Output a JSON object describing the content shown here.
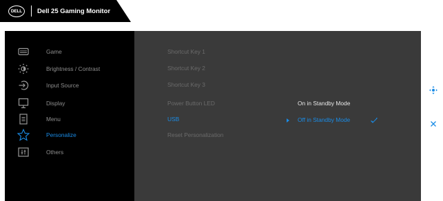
{
  "header": {
    "logo_text": "DELL",
    "title": "Dell 25 Gaming Monitor"
  },
  "menu": [
    {
      "label": "Game",
      "icon": "gamepad-icon",
      "active": false
    },
    {
      "label": "Brightness / Contrast",
      "icon": "brightness-icon",
      "active": false
    },
    {
      "label": "Input Source",
      "icon": "input-source-icon",
      "active": false
    },
    {
      "label": "Display",
      "icon": "display-icon",
      "active": false
    },
    {
      "label": "Menu",
      "icon": "menu-icon",
      "active": false
    },
    {
      "label": "Personalize",
      "icon": "star-icon",
      "active": true
    },
    {
      "label": "Others",
      "icon": "others-icon",
      "active": false
    }
  ],
  "submenu": [
    {
      "label": "Shortcut Key 1",
      "active": false
    },
    {
      "label": "Shortcut Key 2",
      "active": false
    },
    {
      "label": "Shortcut Key 3",
      "active": false
    },
    {
      "label": "Power Button LED",
      "active": false
    },
    {
      "label": "USB",
      "active": true
    },
    {
      "label": "Reset Personalization",
      "active": false
    }
  ],
  "options": [
    {
      "label": "On in Standby Mode",
      "selected": false
    },
    {
      "label": "Off in Standby Mode",
      "selected": true
    }
  ],
  "colors": {
    "accent": "#1a8ce6",
    "panel": "#3a3a3a",
    "background": "#000000"
  },
  "side_icons": [
    "navigation-joystick-icon",
    "close-icon"
  ]
}
